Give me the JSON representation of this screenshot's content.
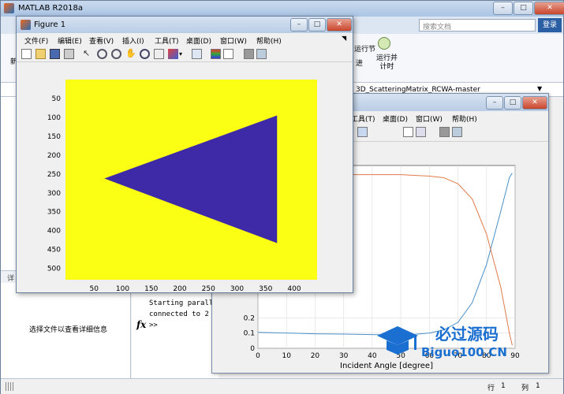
{
  "app": {
    "title": "MATLAB R2018a",
    "search_placeholder": "搜索文档",
    "login": "登录"
  },
  "ribbon": {
    "run_section_label": "运行节",
    "run_advance_label": "进",
    "run_time_label": "运行并\n计时",
    "left_stub": "新"
  },
  "path": {
    "text": "3D_ScatteringMatrix_RCWA-master"
  },
  "left_panel": {
    "detail_stub": "详",
    "detail_text": "选择文件以查看详细信息"
  },
  "command_window": {
    "line1": "Starting paralle",
    "line2": "connected to 2 w",
    "prompt": ">>"
  },
  "status": {
    "row_label": "行",
    "row_value": "1",
    "col_label": "列",
    "col_value": "1"
  },
  "figure1": {
    "title": "Figure 1",
    "menu": [
      "文件(F)",
      "编辑(E)",
      "查看(V)",
      "插入(I)",
      "工具(T)",
      "桌面(D)",
      "窗口(W)",
      "帮助(H)"
    ]
  },
  "figure2": {
    "menu": [
      "工具(T)",
      "桌面(D)",
      "窗口(W)",
      "帮助(H)"
    ]
  },
  "watermark": {
    "title": "必过源码",
    "url": "Biguo100.CN"
  },
  "colors": {
    "image_background": "#faff14",
    "triangle": "#3e2aa6",
    "blue_series": "#4a90c8",
    "orange_series": "#e07a4a"
  },
  "chart_data": [
    {
      "type": "heatmap",
      "title": "",
      "xlabel": "",
      "ylabel": "",
      "xlim": [
        0,
        440
      ],
      "ylim": [
        0,
        530
      ],
      "x_ticks": [
        50,
        100,
        150,
        200,
        250,
        300,
        350,
        400
      ],
      "y_ticks": [
        50,
        100,
        150,
        200,
        250,
        300,
        350,
        400,
        450,
        500
      ],
      "triangle_vertices": [
        [
          68,
          262
        ],
        [
          370,
          433
        ],
        [
          370,
          95
        ]
      ],
      "grid": false
    },
    {
      "type": "line",
      "title": "",
      "xlabel": "Incident Angle [degree]",
      "ylabel": "",
      "xlim": [
        0,
        90
      ],
      "ylim": [
        0,
        0.3
      ],
      "x_ticks": [
        0,
        10,
        20,
        30,
        40,
        50,
        60,
        70,
        80,
        90
      ],
      "y_ticks": [
        0,
        0.1,
        0.2
      ],
      "grid": true,
      "series": [
        {
          "x": [
            0,
            10,
            20,
            30,
            40,
            50,
            55,
            60,
            65,
            70,
            75,
            80,
            85,
            88,
            89
          ],
          "values": [
            0.105,
            0.1,
            0.095,
            0.093,
            0.09,
            0.088,
            0.092,
            0.1,
            0.12,
            0.17,
            0.3,
            0.55,
            0.9,
            1.12,
            1.15
          ]
        },
        {
          "x": [
            0,
            10,
            20,
            30,
            40,
            50,
            60,
            65,
            70,
            75,
            80,
            85,
            88,
            89
          ],
          "values": [
            1.12,
            1.13,
            1.14,
            1.14,
            1.14,
            1.14,
            1.13,
            1.12,
            1.08,
            0.98,
            0.75,
            0.4,
            0.1,
            0.02
          ]
        }
      ]
    }
  ]
}
